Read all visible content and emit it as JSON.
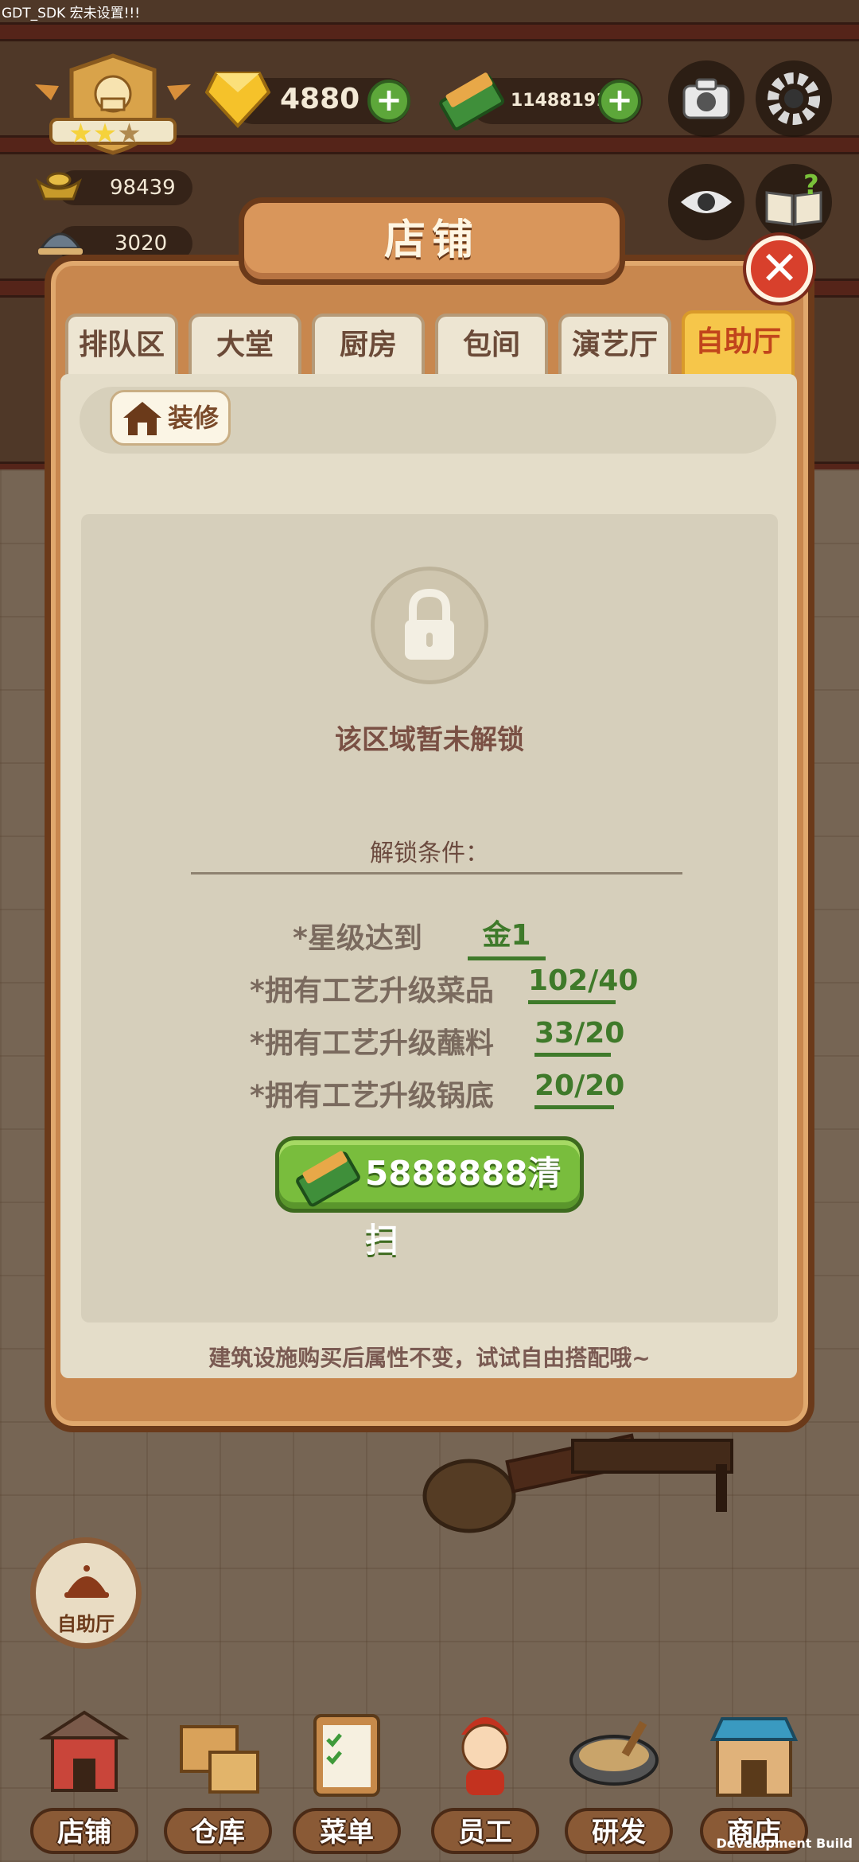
{
  "debug": {
    "top": "GDT_SDK 宏未设置!!!",
    "bottom": "Development Build"
  },
  "hud": {
    "gems": "4880",
    "cash": "114881917",
    "gold_ingot": "98439",
    "dish_count": "3020",
    "star_rating": 2,
    "star_total": 3
  },
  "modal": {
    "title": "店铺",
    "close_icon": "close-icon",
    "tabs": [
      {
        "label": "排队区",
        "active": false
      },
      {
        "label": "大堂",
        "active": false
      },
      {
        "label": "厨房",
        "active": false
      },
      {
        "label": "包间",
        "active": false
      },
      {
        "label": "演艺厅",
        "active": false
      },
      {
        "label": "自助厅",
        "active": true
      }
    ],
    "decor_button": "装修",
    "lock_message": "该区域暂未解锁",
    "conditions_title": "解锁条件：",
    "conditions": [
      {
        "label": "*星级达到",
        "value": "金1"
      },
      {
        "label": "*拥有工艺升级菜品",
        "value": "102/40"
      },
      {
        "label": "*拥有工艺升级蘸料",
        "value": "33/20"
      },
      {
        "label": "*拥有工艺升级锅底",
        "value": "20/20"
      }
    ],
    "sweep_button": {
      "cost": "5888888",
      "action": "清扫"
    },
    "footer_note": "建筑设施购买后属性不变，试试自由搭配哦~"
  },
  "hall_button": "自助厅",
  "bottom_nav": [
    {
      "label": "店铺",
      "icon": "shop-building-icon"
    },
    {
      "label": "仓库",
      "icon": "warehouse-boxes-icon"
    },
    {
      "label": "菜单",
      "icon": "menu-clipboard-icon"
    },
    {
      "label": "员工",
      "icon": "staff-chef-icon"
    },
    {
      "label": "研发",
      "icon": "research-wok-icon"
    },
    {
      "label": "商店",
      "icon": "store-icon"
    }
  ],
  "colors": {
    "accent_green": "#79bd3d",
    "active_tab": "#f6c64a",
    "close_red": "#d8402c",
    "frame_brown": "#c8874e"
  }
}
